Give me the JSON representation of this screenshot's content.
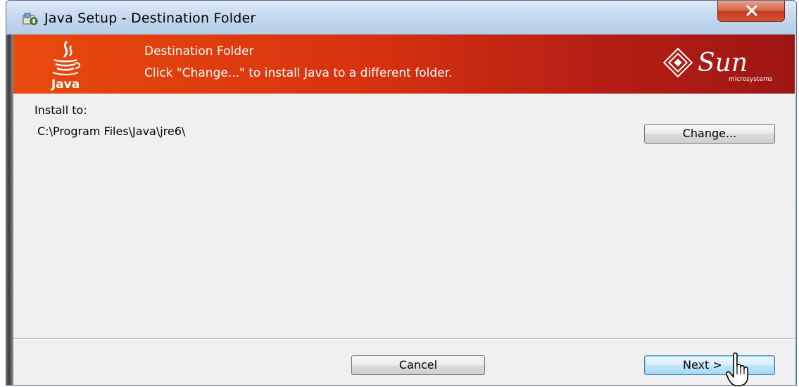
{
  "window": {
    "title": "Java Setup - Destination Folder",
    "close_label": "x"
  },
  "banner": {
    "title": "Destination Folder",
    "subtitle": "Click \"Change...\" to install Java to a different folder.",
    "java_logo_text": "Java",
    "sun_logo_text": "Sun",
    "sun_logo_subtext": "microsystems"
  },
  "content": {
    "install_label": "Install to:",
    "install_path": "C:\\Program Files\\Java\\jre6\\",
    "change_button": "Change..."
  },
  "footer": {
    "cancel_button": "Cancel",
    "next_button": "Next >"
  },
  "colors": {
    "banner_start": "#e84a0e",
    "banner_end": "#9e1614",
    "close_button": "#c4391b"
  }
}
